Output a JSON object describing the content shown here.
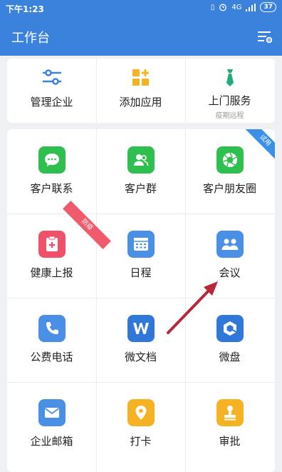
{
  "status_bar": {
    "time": "下午1:23",
    "network": "4G",
    "battery": "37"
  },
  "app_bar": {
    "title": "工作台"
  },
  "top_row": [
    {
      "label": "管理企业",
      "icon": "sliders-icon"
    },
    {
      "label": "添加应用",
      "icon": "add-apps-icon"
    },
    {
      "label": "上门服务",
      "sub": "疫期远程",
      "icon": "necktie-icon"
    }
  ],
  "apps": [
    {
      "label": "客户联系",
      "icon": "chat-bubble-icon",
      "color": "#2fbf4e"
    },
    {
      "label": "客户群",
      "icon": "group-icon",
      "color": "#2fbf4e"
    },
    {
      "label": "客户朋友圈",
      "icon": "aperture-icon",
      "color": "#2fbf4e",
      "ribbon": "试用"
    },
    {
      "label": "健康上报",
      "icon": "health-clipboard-icon",
      "color": "#f0516a",
      "ribbon": "防疫"
    },
    {
      "label": "日程",
      "icon": "calendar-icon",
      "color": "#4a8fe6"
    },
    {
      "label": "会议",
      "icon": "meeting-icon",
      "color": "#4a8fe6"
    },
    {
      "label": "公费电话",
      "icon": "phone-icon",
      "color": "#4a8fe6"
    },
    {
      "label": "微文档",
      "icon": "doc-w-icon",
      "color": "#2f77d8"
    },
    {
      "label": "微盘",
      "icon": "drive-icon",
      "color": "#2f77d8"
    },
    {
      "label": "企业邮箱",
      "icon": "mail-icon",
      "color": "#4a8fe6"
    },
    {
      "label": "打卡",
      "icon": "location-pin-icon",
      "color": "#f5b323"
    },
    {
      "label": "审批",
      "icon": "stamp-icon",
      "color": "#f5b323"
    }
  ],
  "colors": {
    "primary": "#3a82dc",
    "ribbon_blue": "#3a90e6",
    "ribbon_red": "#ef5a6c",
    "arrow": "#b8263a"
  }
}
